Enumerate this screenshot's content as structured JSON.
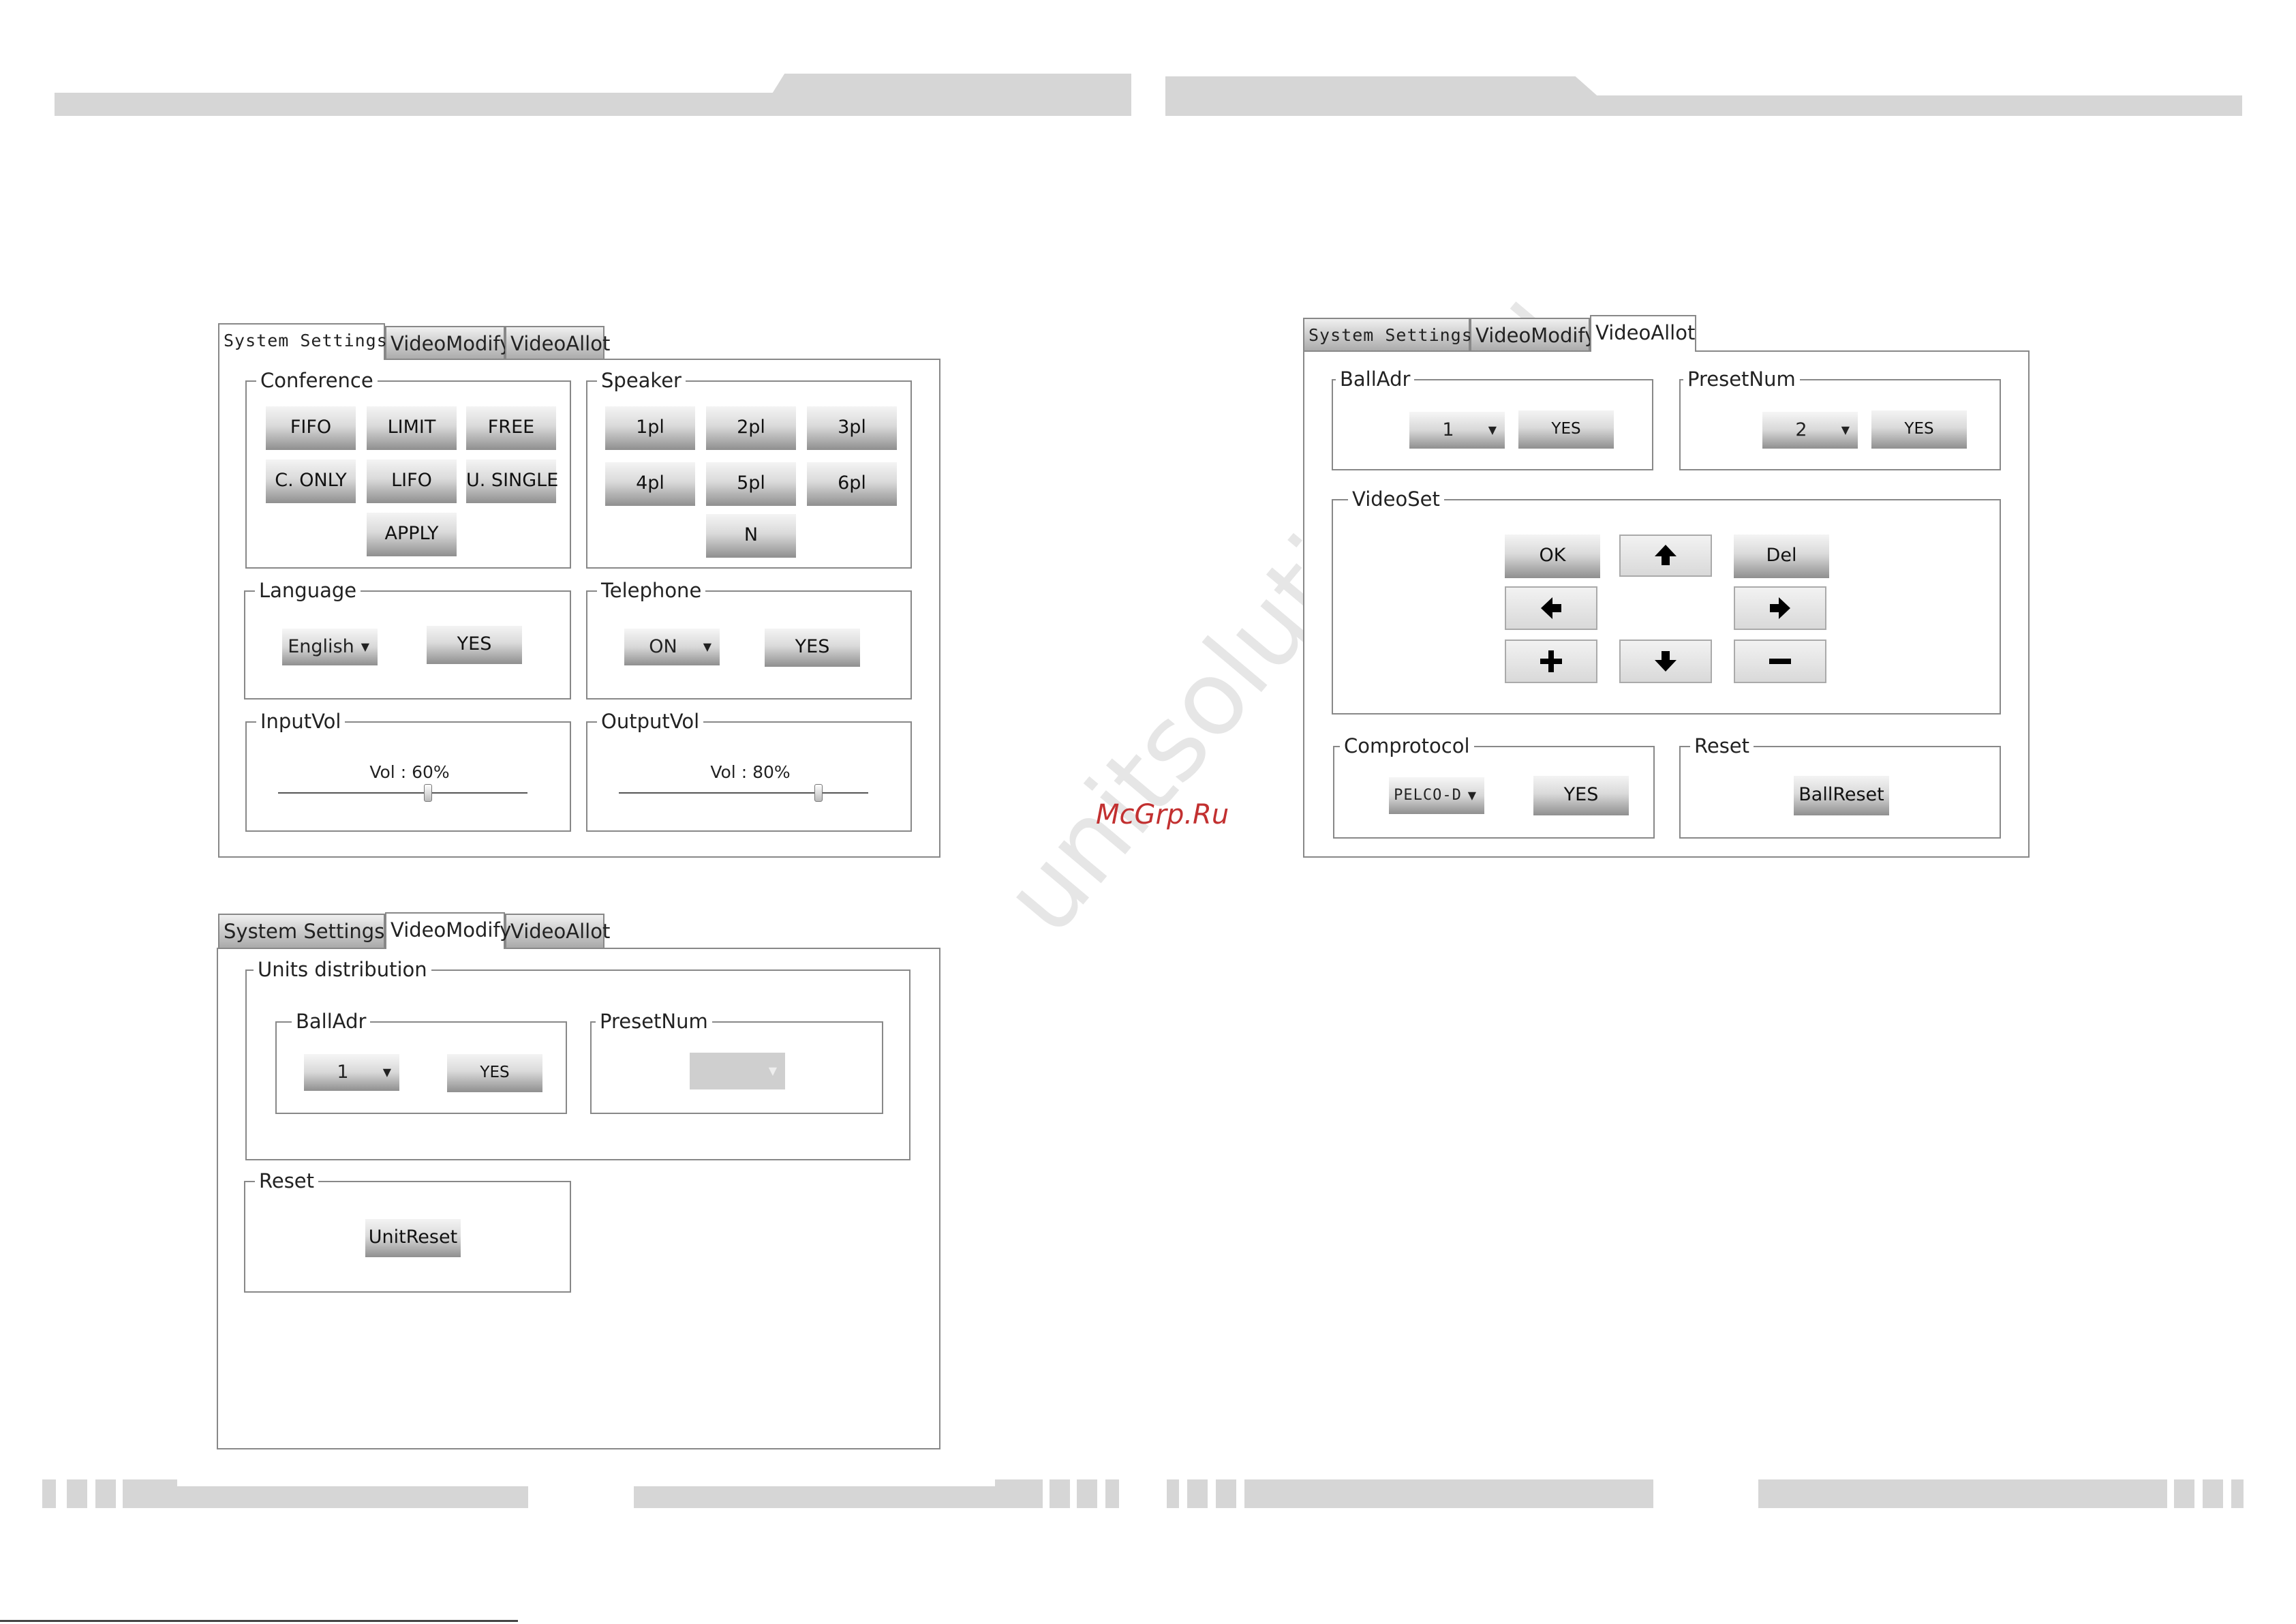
{
  "tabs": {
    "system_settings": "System Settings",
    "video_modify": "VideoModify",
    "video_allot": "VideoAllot"
  },
  "panel1": {
    "conference": {
      "title": "Conference",
      "buttons": [
        "FIFO",
        "LIMIT",
        "FREE",
        "C. ONLY",
        "LIFO",
        "U. SINGLE"
      ],
      "apply": "APPLY"
    },
    "speaker": {
      "title": "Speaker",
      "buttons": [
        "1pl",
        "2pl",
        "3pl",
        "4pl",
        "5pl",
        "6pl"
      ],
      "n": "N"
    },
    "language": {
      "title": "Language",
      "value": "English",
      "yes": "YES"
    },
    "telephone": {
      "title": "Telephone",
      "value": "ON",
      "yes": "YES"
    },
    "inputvol": {
      "title": "InputVol",
      "label": "Vol : 60%",
      "level": 0.6
    },
    "outputvol": {
      "title": "OutputVol",
      "label": "Vol : 80%",
      "level": 0.8
    }
  },
  "panel2": {
    "units": {
      "title": "Units distribution"
    },
    "balladr": {
      "title": "BallAdr",
      "value": "1",
      "yes": "YES"
    },
    "presetnum": {
      "title": "PresetNum",
      "value": ""
    },
    "reset": {
      "title": "Reset",
      "button": "UnitReset"
    }
  },
  "panel3": {
    "balladr": {
      "title": "BallAdr",
      "value": "1",
      "yes": "YES"
    },
    "presetnum": {
      "title": "PresetNum",
      "value": "2",
      "yes": "YES"
    },
    "videoset": {
      "title": "VideoSet",
      "ok": "OK",
      "del": "Del"
    },
    "comprotocol": {
      "title": "Comprotocol",
      "value": "PELCO-D",
      "yes": "YES"
    },
    "reset": {
      "title": "Reset",
      "button": "BallReset"
    }
  },
  "watermark": "unitsolutions.ru",
  "mcgrp": "McGrp.Ru",
  "colors": {
    "border": "#888888",
    "bar": "#d6d6d6",
    "mcgrp": "#c23030"
  }
}
